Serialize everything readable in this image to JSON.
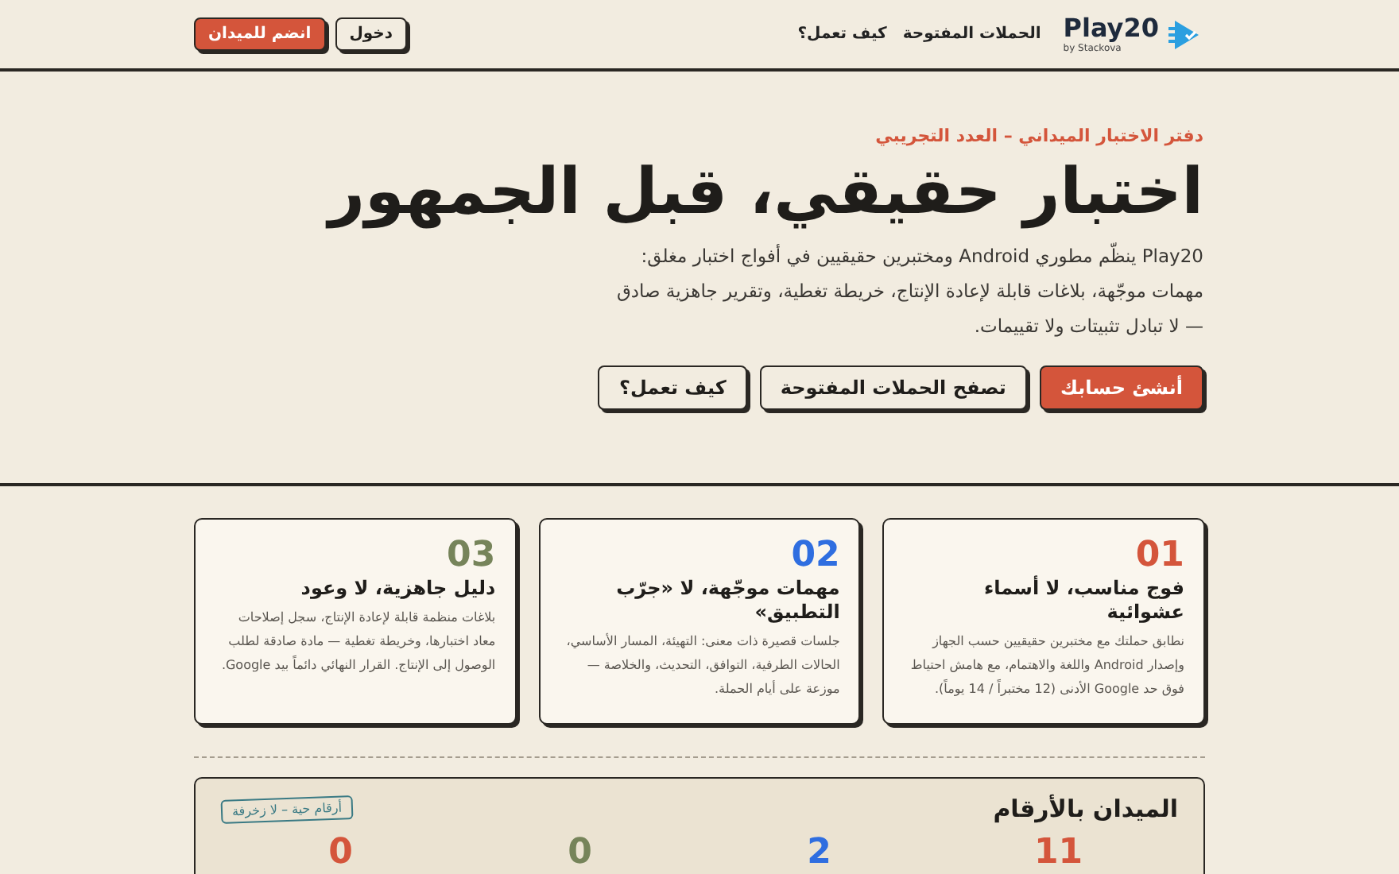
{
  "header": {
    "brand": "Play20",
    "brand_sub": "by Stackova",
    "nav": [
      "الحملات المفتوحة",
      "كيف تعمل؟"
    ],
    "buttons": [
      {
        "label": "دخول",
        "kind": "secondary"
      },
      {
        "label": "انضم للميدان",
        "kind": "primary"
      }
    ]
  },
  "hero": {
    "eyebrow": "دفتر الاختبار الميداني – العدد التجريبي",
    "title": "اختبار حقيقي، قبل الجمهور",
    "text": "Play20 ينظّم مطوري Android ومختبرين حقيقيين في أفواج اختبار مغلق: مهمات موجّهة، بلاغات قابلة لإعادة الإنتاج، خريطة تغطية، وتقرير جاهزية صادق — لا تبادل تثبيتات ولا تقييمات.",
    "buttons": [
      {
        "label": "أنشئ حسابك",
        "kind": "primary"
      },
      {
        "label": "تصفح الحملات المفتوحة",
        "kind": "secondary"
      },
      {
        "label": "كيف تعمل؟",
        "kind": "secondary"
      }
    ]
  },
  "cards": [
    {
      "number": "01",
      "color": "#d4553b",
      "title": "فوج مناسب، لا أسماء عشوائية",
      "text": "نطابق حملتك مع مختبرين حقيقيين حسب الجهاز وإصدار Android واللغة والاهتمام، مع هامش احتياط فوق حد Google الأدنى (12 مختبراً / 14 يوماً)."
    },
    {
      "number": "02",
      "color": "#2f6ee0",
      "title": "مهمات موجّهة، لا «جرّب التطبيق»",
      "text": "جلسات قصيرة ذات معنى: التهيئة، المسار الأساسي، الحالات الطرفية، التوافق، التحديث، والخلاصة — موزعة على أيام الحملة."
    },
    {
      "number": "03",
      "color": "#76845a",
      "title": "دليل جاهزية، لا وعود",
      "text": "بلاغات منظمة قابلة لإعادة الإنتاج، سجل إصلاحات معاد اختبارها، وخريطة تغطية — مادة صادقة لطلب الوصول إلى الإنتاج. القرار النهائي دائماً بيد Google."
    }
  ],
  "stats": {
    "title": "الميدان بالأرقام",
    "tag": "أرقام حية – لا زخرفة",
    "items": [
      {
        "value": "11",
        "color": "#d4553b"
      },
      {
        "value": "2",
        "color": "#2f6ee0"
      },
      {
        "value": "0",
        "color": "#76845a"
      },
      {
        "value": "0",
        "color": "#d4553b"
      }
    ]
  }
}
